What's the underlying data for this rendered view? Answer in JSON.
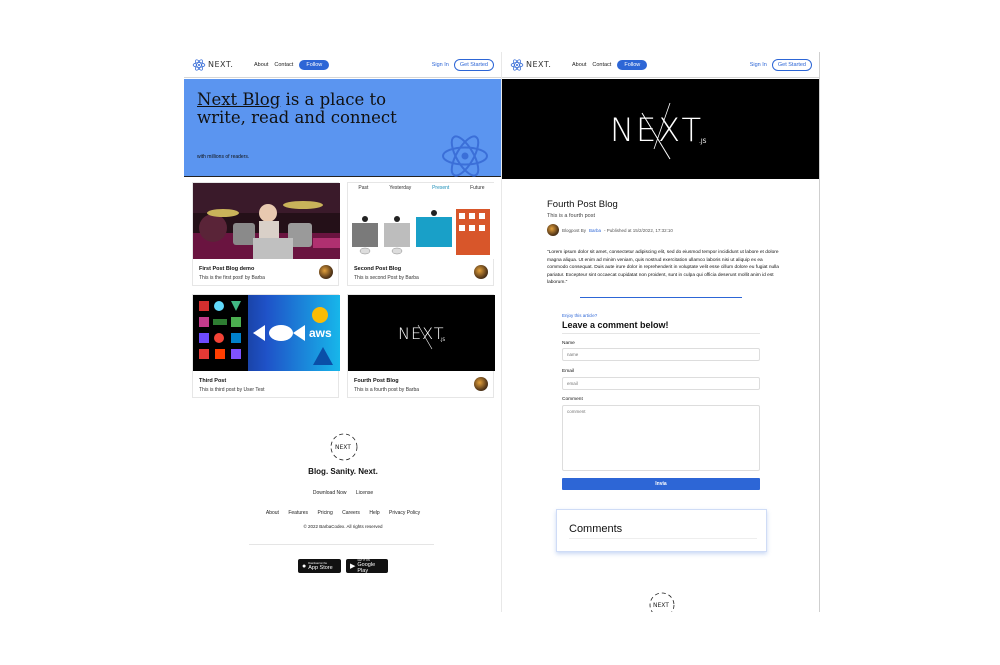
{
  "left": {
    "nav": {
      "logo_text": "NEXT.",
      "links": [
        "About",
        "Contact"
      ],
      "follow": "Follow",
      "sign_in": "Sign In",
      "get_started": "Get Started"
    },
    "hero": {
      "title_link": "Next Blog",
      "title_rest": " is a place to write, read and connect",
      "subtitle": "with millions of readers."
    },
    "cards": [
      {
        "title": "First Post Blog demo",
        "subtitle": "This is the first post! by Barba"
      },
      {
        "title": "Second Post Blog",
        "subtitle": "This is second Post by Barba",
        "timeline": [
          "Past",
          "Yesterday",
          "Present",
          "Future"
        ]
      },
      {
        "title": "Third Post",
        "subtitle": "This is third post by User Test"
      },
      {
        "title": "Fourth Post Blog",
        "subtitle": "This is a fourth post by Barba"
      }
    ],
    "footer": {
      "logo_text": "NEXT",
      "brand": "Blog. Sanity. Next.",
      "row1": [
        "Download Now",
        "License"
      ],
      "row2": [
        "About",
        "Features",
        "Pricing",
        "Careers",
        "Help",
        "Privacy Policy"
      ],
      "copyright": "© 2022 BarbaCodex. All rights reserved",
      "app_store_small": "Download on the",
      "app_store_big": "App Store",
      "google_small": "GET IT ON",
      "google_big": "Google Play"
    }
  },
  "right": {
    "nav": {
      "logo_text": "NEXT.",
      "links": [
        "About",
        "Contact"
      ],
      "follow": "Follow",
      "sign_in": "Sign In",
      "get_started": "Get Started"
    },
    "banner_text": "NEXT",
    "banner_suffix": ".JS",
    "post": {
      "title": "Fourth Post Blog",
      "subtitle": "This is a fourth post",
      "meta_prefix": "Blogpost By",
      "meta_author": "Barba",
      "meta_suffix": "- Published at 15/2/2022, 17:32:10",
      "body": "\"Lorem ipsum dolor sit amet, consectetur adipiscing elit, sed do eiusmod tempor incididunt ut labore et dolore magna aliqua. Ut enim ad minim veniam, quis nostrud exercitation ullamco laboris nisi ut aliquip ex ea commodo consequat. Duis aute irure dolor in reprehenderit in voluptate velit esse cillum dolore eu fugiat nulla pariatur. Excepteur sint occaecat cupidatat non proident, sunt in culpa qui officia deserunt mollit anim id est laborum.\""
    },
    "comment_form": {
      "enjoy": "Enjoy this article?",
      "heading": "Leave a comment below!",
      "name_label": "Name",
      "name_placeholder": "name",
      "email_label": "Email",
      "email_placeholder": "email",
      "comment_label": "Comment",
      "comment_placeholder": "comment",
      "submit": "Invia"
    },
    "comments_title": "Comments",
    "footer_logo_text": "NEXT"
  },
  "colors": {
    "accent": "#2d66d6",
    "hero_bg": "#5b95f0",
    "react_atom": "#3b6fd8"
  }
}
